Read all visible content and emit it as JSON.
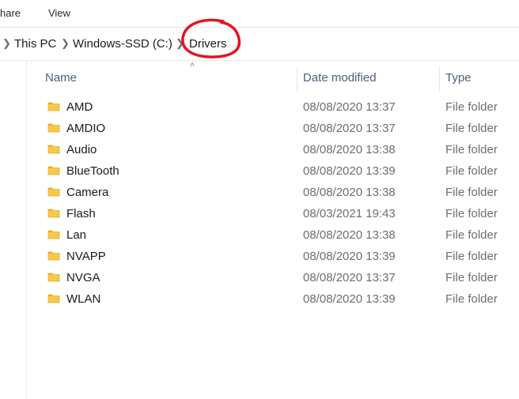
{
  "ribbon": {
    "tabs": [
      "hare",
      "View"
    ]
  },
  "breadcrumb": {
    "items": [
      "This PC",
      "Windows-SSD (C:)",
      "Drivers"
    ]
  },
  "columns": {
    "name": "Name",
    "date": "Date modified",
    "type": "Type"
  },
  "files": [
    {
      "name": "AMD",
      "date": "08/08/2020 13:37",
      "type": "File folder"
    },
    {
      "name": "AMDIO",
      "date": "08/08/2020 13:37",
      "type": "File folder"
    },
    {
      "name": "Audio",
      "date": "08/08/2020 13:38",
      "type": "File folder"
    },
    {
      "name": "BlueTooth",
      "date": "08/08/2020 13:39",
      "type": "File folder"
    },
    {
      "name": "Camera",
      "date": "08/08/2020 13:38",
      "type": "File folder"
    },
    {
      "name": "Flash",
      "date": "08/03/2021 19:43",
      "type": "File folder"
    },
    {
      "name": "Lan",
      "date": "08/08/2020 13:38",
      "type": "File folder"
    },
    {
      "name": "NVAPP",
      "date": "08/08/2020 13:39",
      "type": "File folder"
    },
    {
      "name": "NVGA",
      "date": "08/08/2020 13:37",
      "type": "File folder"
    },
    {
      "name": "WLAN",
      "date": "08/08/2020 13:39",
      "type": "File folder"
    }
  ],
  "colors": {
    "folder": "#f7c948",
    "folder_dark": "#e3a82b",
    "annotation": "#e8121e"
  },
  "icons": {
    "folder": "folder-icon",
    "chevron": "chevron-right-icon",
    "sort": "sort-up-icon"
  }
}
